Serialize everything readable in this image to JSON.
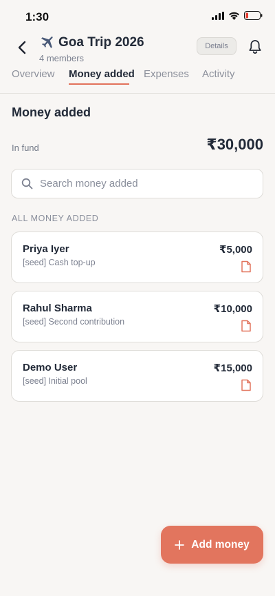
{
  "status_bar": {
    "time": "1:30"
  },
  "header": {
    "title": "Goa Trip 2026",
    "members": "4 members",
    "details_label": "Details"
  },
  "tabs": [
    {
      "label": "Overview",
      "active": false
    },
    {
      "label": "Money added",
      "active": true
    },
    {
      "label": "Expenses",
      "active": false
    },
    {
      "label": "Activity",
      "active": false
    }
  ],
  "main": {
    "section_title": "Money added",
    "fund_label": "In fund",
    "fund_amount": "₹30,000",
    "search_placeholder": "Search money added",
    "list_header": "ALL MONEY ADDED",
    "entries": [
      {
        "name": "Priya Iyer",
        "note": "[seed] Cash top-up",
        "amount": "₹5,000",
        "icon": "document-icon"
      },
      {
        "name": "Rahul Sharma",
        "note": "[seed] Second contribution",
        "amount": "₹10,000",
        "icon": "document-icon"
      },
      {
        "name": "Demo User",
        "note": "[seed] Initial pool",
        "amount": "₹15,000",
        "icon": "document-icon"
      }
    ]
  },
  "fab": {
    "label": "Add money",
    "icon": "plus-icon"
  },
  "colors": {
    "accent": "#e2755e",
    "background": "#f8f6f4",
    "text": "#222a38"
  }
}
